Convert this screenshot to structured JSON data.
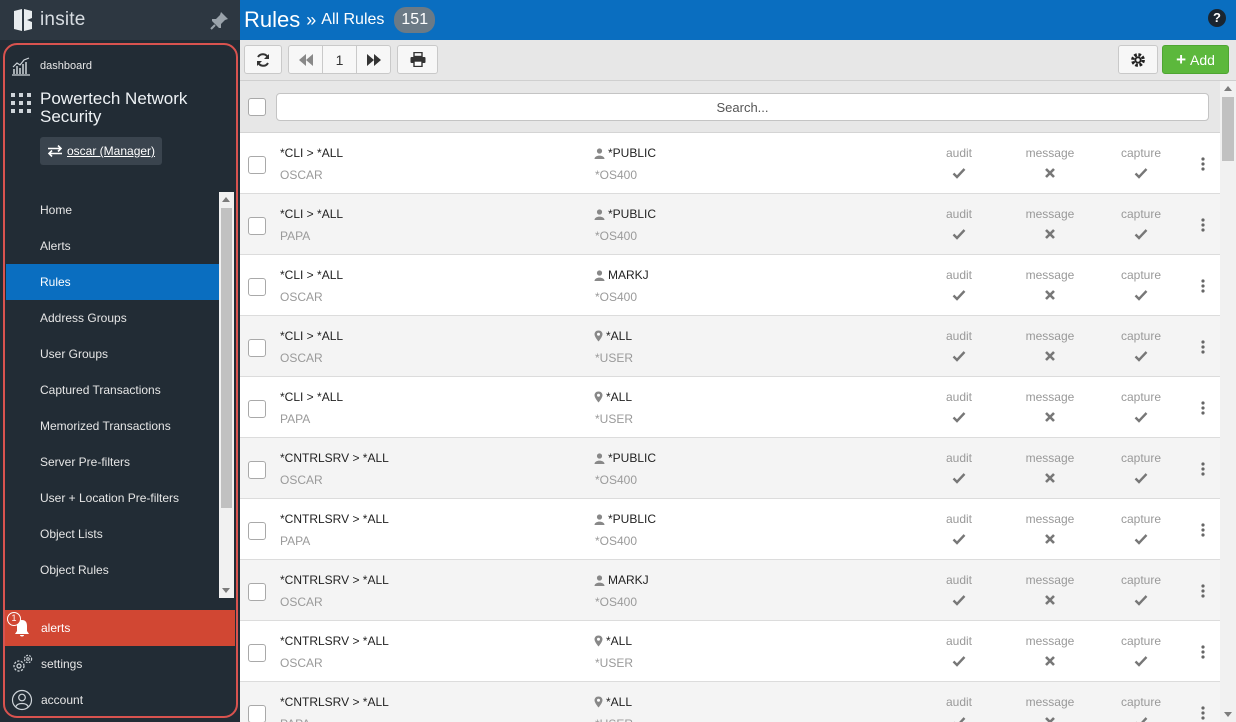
{
  "sidebar": {
    "brand": "insite",
    "dashboard_label": "dashboard",
    "product_name": "Powertech Network Security",
    "user_switch": "oscar (Manager)",
    "nav_items": [
      {
        "label": "Home",
        "active": false
      },
      {
        "label": "Alerts",
        "active": false
      },
      {
        "label": "Rules",
        "active": true
      },
      {
        "label": "Address Groups",
        "active": false
      },
      {
        "label": "User Groups",
        "active": false
      },
      {
        "label": "Captured Transactions",
        "active": false
      },
      {
        "label": "Memorized Transactions",
        "active": false
      },
      {
        "label": "Server Pre-filters",
        "active": false
      },
      {
        "label": "User + Location Pre-filters",
        "active": false
      },
      {
        "label": "Object Lists",
        "active": false
      },
      {
        "label": "Object Rules",
        "active": false
      }
    ],
    "bottom": {
      "alerts_label": "alerts",
      "alerts_count": "1",
      "settings_label": "settings",
      "account_label": "account"
    }
  },
  "header": {
    "title": "Rules",
    "separator": "»",
    "subtitle": "All Rules",
    "count": "151",
    "help": "?"
  },
  "toolbar": {
    "page_number": "1",
    "add_label": "Add"
  },
  "search": {
    "placeholder": "Search..."
  },
  "flag_labels": {
    "audit": "audit",
    "message": "message",
    "capture": "capture"
  },
  "rules": [
    {
      "name": "*CLI > *ALL",
      "location": "OSCAR",
      "who": "*PUBLIC",
      "who_type": "user",
      "server": "*OS400",
      "audit": true,
      "message": false,
      "capture": true
    },
    {
      "name": "*CLI > *ALL",
      "location": "PAPA",
      "who": "*PUBLIC",
      "who_type": "user",
      "server": "*OS400",
      "audit": true,
      "message": false,
      "capture": true
    },
    {
      "name": "*CLI > *ALL",
      "location": "OSCAR",
      "who": "MARKJ",
      "who_type": "user",
      "server": "*OS400",
      "audit": true,
      "message": false,
      "capture": true
    },
    {
      "name": "*CLI > *ALL",
      "location": "OSCAR",
      "who": "*ALL",
      "who_type": "location",
      "server": "*USER",
      "audit": true,
      "message": false,
      "capture": true
    },
    {
      "name": "*CLI > *ALL",
      "location": "PAPA",
      "who": "*ALL",
      "who_type": "location",
      "server": "*USER",
      "audit": true,
      "message": false,
      "capture": true
    },
    {
      "name": "*CNTRLSRV > *ALL",
      "location": "OSCAR",
      "who": "*PUBLIC",
      "who_type": "user",
      "server": "*OS400",
      "audit": true,
      "message": false,
      "capture": true
    },
    {
      "name": "*CNTRLSRV > *ALL",
      "location": "PAPA",
      "who": "*PUBLIC",
      "who_type": "user",
      "server": "*OS400",
      "audit": true,
      "message": false,
      "capture": true
    },
    {
      "name": "*CNTRLSRV > *ALL",
      "location": "OSCAR",
      "who": "MARKJ",
      "who_type": "user",
      "server": "*OS400",
      "audit": true,
      "message": false,
      "capture": true
    },
    {
      "name": "*CNTRLSRV > *ALL",
      "location": "OSCAR",
      "who": "*ALL",
      "who_type": "location",
      "server": "*USER",
      "audit": true,
      "message": false,
      "capture": true
    },
    {
      "name": "*CNTRLSRV > *ALL",
      "location": "PAPA",
      "who": "*ALL",
      "who_type": "location",
      "server": "*USER",
      "audit": true,
      "message": false,
      "capture": true
    }
  ],
  "colors": {
    "brand_blue": "#0a6ec0",
    "sidebar_bg": "#222c35",
    "alert_red": "#d14733",
    "add_green": "#5cb83c"
  }
}
